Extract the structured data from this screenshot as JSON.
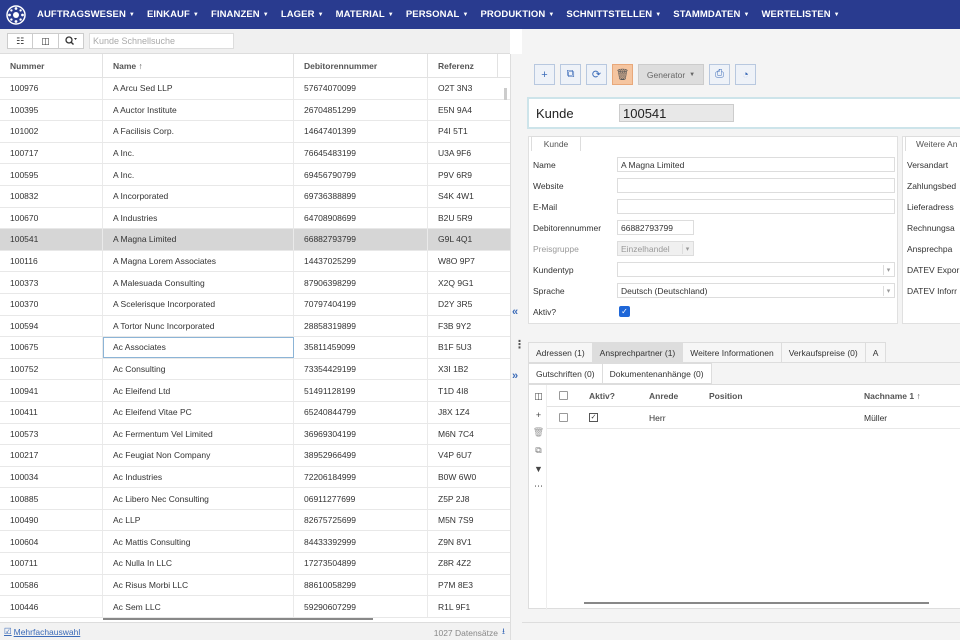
{
  "nav": {
    "logo": "logo-icon",
    "items": [
      "AUFTRAGSWESEN",
      "EINKAUF",
      "FINANZEN",
      "LAGER",
      "MATERIAL",
      "PERSONAL",
      "PRODUKTION",
      "SCHNITTSTELLEN",
      "STAMMDATEN",
      "WERTELISTEN"
    ]
  },
  "left_toolbar": {
    "search_placeholder": "Kunde Schnellsuche"
  },
  "grid": {
    "columns": [
      "Nummer",
      "Name ↑",
      "Debitorennummer",
      "Referenz"
    ],
    "rows": [
      [
        "100976",
        "A Arcu Sed LLP",
        "57674070099",
        "O2T 3N3"
      ],
      [
        "100395",
        "A Auctor Institute",
        "26704851299",
        "E5N 9A4"
      ],
      [
        "101002",
        "A Facilisis Corp.",
        "14647401399",
        "P4I 5T1"
      ],
      [
        "100717",
        "A Inc.",
        "76645483199",
        "U3A 9F6"
      ],
      [
        "100595",
        "A Inc.",
        "69456790799",
        "P9V 6R9"
      ],
      [
        "100832",
        "A Incorporated",
        "69736388899",
        "S4K 4W1"
      ],
      [
        "100670",
        "A Industries",
        "64708908699",
        "B2U 5R9"
      ],
      [
        "100541",
        "A Magna Limited",
        "66882793799",
        "G9L 4Q1"
      ],
      [
        "100116",
        "A Magna Lorem Associates",
        "14437025299",
        "W8O 9P7"
      ],
      [
        "100373",
        "A Malesuada Consulting",
        "87906398299",
        "X2Q 9G1"
      ],
      [
        "100370",
        "A Scelerisque Incorporated",
        "70797404199",
        "D2Y 3R5"
      ],
      [
        "100594",
        "A Tortor Nunc Incorporated",
        "28858319899",
        "F3B 9Y2"
      ],
      [
        "100675",
        "Ac Associates",
        "35811459099",
        "B1F 5U3"
      ],
      [
        "100752",
        "Ac Consulting",
        "73354429199",
        "X3I 1B2"
      ],
      [
        "100941",
        "Ac Eleifend Ltd",
        "51491128199",
        "T1D 4I8"
      ],
      [
        "100411",
        "Ac Eleifend Vitae PC",
        "65240844799",
        "J8X 1Z4"
      ],
      [
        "100573",
        "Ac Fermentum Vel Limited",
        "36969304199",
        "M6N 7C4"
      ],
      [
        "100217",
        "Ac Feugiat Non Company",
        "38952966499",
        "V4P 6U7"
      ],
      [
        "100034",
        "Ac Industries",
        "72206184999",
        "B0W 6W0"
      ],
      [
        "100885",
        "Ac Libero Nec Consulting",
        "06911277699",
        "Z5P 2J8"
      ],
      [
        "100490",
        "Ac LLP",
        "82675725699",
        "M5N 7S9"
      ],
      [
        "100604",
        "Ac Mattis Consulting",
        "84433392999",
        "Z9N 8V1"
      ],
      [
        "100711",
        "Ac Nulla In LLC",
        "17273504899",
        "Z8R 4Z2"
      ],
      [
        "100586",
        "Ac Risus Morbi LLC",
        "88610058299",
        "P7M 8E3"
      ],
      [
        "100446",
        "Ac Sem LLC",
        "59290607299",
        "R1L 9F1"
      ]
    ],
    "selected_row": 7,
    "focused_row": 12
  },
  "footer": {
    "multi_label": "Mehrfachauswahl",
    "count": "1027 Datensätze"
  },
  "toolbar": {
    "generator_label": "Generator"
  },
  "record": {
    "title_label": "Kunde",
    "number": "100541"
  },
  "kunde_panel": {
    "tab": "Kunde",
    "name_label": "Name",
    "name_value": "A Magna Limited",
    "website_label": "Website",
    "email_label": "E-Mail",
    "debitor_label": "Debitorennummer",
    "debitor_value": "66882793799",
    "preisgruppe_label": "Preisgruppe",
    "preisgruppe_value": "Einzelhandel",
    "kundentyp_label": "Kundentyp",
    "sprache_label": "Sprache",
    "sprache_value": "Deutsch (Deutschland)",
    "aktiv_label": "Aktiv?",
    "aktiv": true
  },
  "weitere_panel": {
    "tab": "Weitere An",
    "labels": [
      "Versandart",
      "Zahlungsbed",
      "Lieferadress",
      "Rechnungsa",
      "Ansprechpa",
      "DATEV Expor",
      "DATEV Inforr"
    ]
  },
  "tabs_row1": [
    "Adressen (1)",
    "Ansprechpartner (1)",
    "Weitere Informationen",
    "Verkaufspreise (0)",
    "A"
  ],
  "tabs_active": 1,
  "tabs_row2": [
    "Gutschriften (0)",
    "Dokumentenanhänge (0)"
  ],
  "subgrid": {
    "columns": [
      "Aktiv?",
      "Anrede",
      "Position",
      "Nachname 1 ↑"
    ],
    "rows": [
      {
        "aktiv": true,
        "anrede": "Herr",
        "position": "",
        "nachname": "Müller"
      }
    ]
  }
}
